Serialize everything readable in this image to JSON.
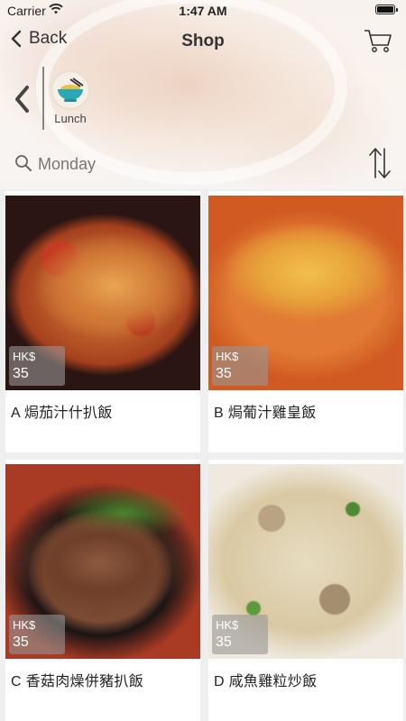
{
  "status_bar": {
    "carrier": "Carrier",
    "time": "1:47 AM"
  },
  "nav": {
    "back_label": "Back",
    "title": "Shop"
  },
  "categories": [
    {
      "label": "Lunch"
    }
  ],
  "search": {
    "value": "Monday"
  },
  "products": [
    {
      "name": "A 焗茄汁什扒飯",
      "currency": "HK$",
      "price": "35"
    },
    {
      "name": "B 焗葡汁雞皇飯",
      "currency": "HK$",
      "price": "35"
    },
    {
      "name": "C 香菇肉燥併豬扒飯",
      "currency": "HK$",
      "price": "35"
    },
    {
      "name": "D 咸魚雞粒炒飯",
      "currency": "HK$",
      "price": "35"
    }
  ]
}
